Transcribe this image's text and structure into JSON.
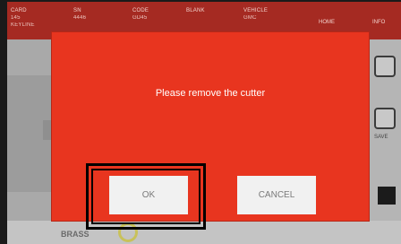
{
  "header": {
    "fields": [
      {
        "key": "CARD",
        "value": "145\nKEYLINE"
      },
      {
        "key": "SN",
        "value": "4446"
      },
      {
        "key": "CODE",
        "value": "GD45"
      },
      {
        "key": "BLANK",
        "value": ""
      },
      {
        "key": "VEHICLE",
        "value": "GMC"
      }
    ],
    "nav": [
      "HOME",
      "INFO"
    ]
  },
  "sidebar_right": {
    "save_label": "SAVE"
  },
  "bottom": {
    "label": "BRASS"
  },
  "dialog": {
    "message": "Please remove the cutter",
    "ok_label": "OK",
    "cancel_label": "CANCEL"
  },
  "colors": {
    "dialog_bg": "#e8351f",
    "header_bg": "#a52a22",
    "highlight": "#000000"
  }
}
